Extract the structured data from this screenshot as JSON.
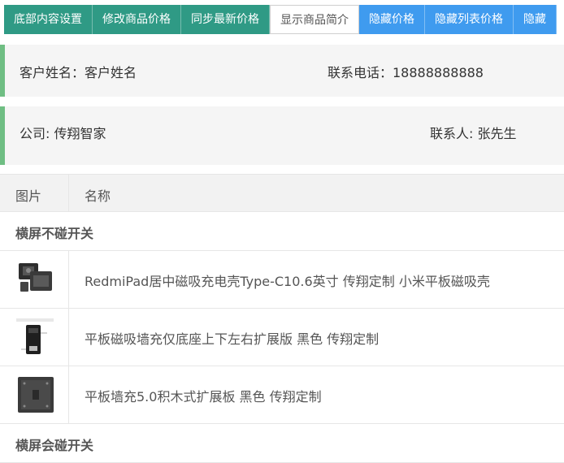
{
  "toolbar": {
    "buttons": [
      {
        "label": "底部内容设置",
        "style": "green"
      },
      {
        "label": "修改商品价格",
        "style": "green"
      },
      {
        "label": "同步最新价格",
        "style": "green"
      },
      {
        "label": "显示商品简介",
        "style": "white"
      },
      {
        "label": "隐藏价格",
        "style": "blue"
      },
      {
        "label": "隐藏列表价格",
        "style": "blue"
      },
      {
        "label": "隐藏",
        "style": "blue"
      }
    ]
  },
  "customer": {
    "name_text": "客户姓名：客户姓名",
    "phone_text": "联系电话：18888888888",
    "company_text": "公司: 传翔智家",
    "contact_text": "联系人: 张先生"
  },
  "table": {
    "headers": [
      "图片",
      "名称"
    ],
    "group1": "横屏不碰开关",
    "rows": [
      {
        "name": "RedmiPad居中磁吸充电壳Type-C10.6英寸 传翔定制 小米平板磁吸壳",
        "image": "product-photo-tablet-case"
      },
      {
        "name": "平板磁吸墙充仅底座上下左右扩展版 黑色 传翔定制",
        "image": "product-photo-wall-mount"
      },
      {
        "name": "平板墙充5.0积木式扩展板 黑色 传翔定制",
        "image": "product-photo-extension-board"
      }
    ],
    "group2": "横屏会碰开关"
  },
  "colors": {
    "green": "#2f9a85",
    "blue": "#3f9bef",
    "accent_bar": "#6fbe83"
  }
}
